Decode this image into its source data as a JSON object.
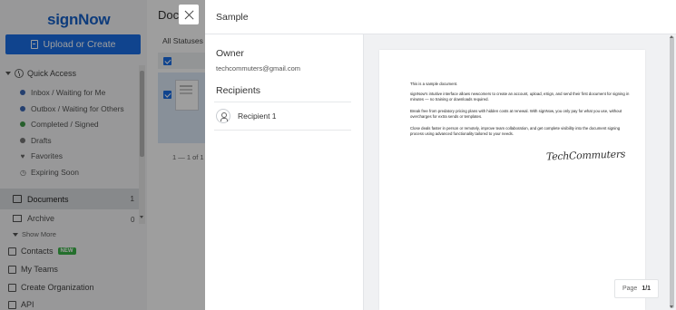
{
  "sidebar": {
    "logo": "signNow",
    "upload_label": "Upload or Create",
    "quick_access": "Quick Access",
    "items": [
      {
        "label": "Inbox / Waiting for Me",
        "icon": "dot",
        "color": "#3a67b4"
      },
      {
        "label": "Outbox / Waiting for Others",
        "icon": "dot",
        "color": "#3a67b4"
      },
      {
        "label": "Completed / Signed",
        "icon": "dot",
        "color": "#3f9a48"
      },
      {
        "label": "Drafts",
        "icon": "dot",
        "color": "#777777"
      },
      {
        "label": "Favorites",
        "icon": "heart",
        "color": "#666666"
      },
      {
        "label": "Expiring Soon",
        "icon": "clock",
        "color": "#666666"
      }
    ],
    "documents_label": "Documents",
    "documents_count": "1",
    "archive_label": "Archive",
    "archive_count": "0",
    "show_more": "Show More",
    "contacts_label": "Contacts",
    "contacts_badge": "NEW",
    "teams_label": "My Teams",
    "create_org_label": "Create Organization",
    "api_label": "API"
  },
  "documents": {
    "title": "Docum",
    "filter": "All Statuses",
    "pager": "1 — 1 of 1"
  },
  "modal": {
    "title": "Sample",
    "owner_label": "Owner",
    "owner_email": "techcommuters@gmail.com",
    "recipients_label": "Recipients",
    "recipients": [
      {
        "label": "Recipient 1"
      }
    ],
    "doc_paragraphs": [
      "This is a sample document.",
      "signNow's intuitive interface allows newcomers to create an account, upload, eSign, and send their first document for signing in minutes — no training or downloads required.",
      "Break free from predatory pricing plans with hidden costs at renewal. With signNow, you only pay for what you use, without overcharges for extra sends or templates.",
      "Close deals faster in person or remotely, improve team collaboration, and get complete visibility into the document signing process using advanced functionality tailored to your needs."
    ],
    "signature": "TechCommuters",
    "page_label": "Page",
    "page_value": "1/1"
  },
  "colors": {
    "brand": "#1560c8",
    "upload_button": "#1a6ee6",
    "new_badge": "#3bb34a"
  }
}
